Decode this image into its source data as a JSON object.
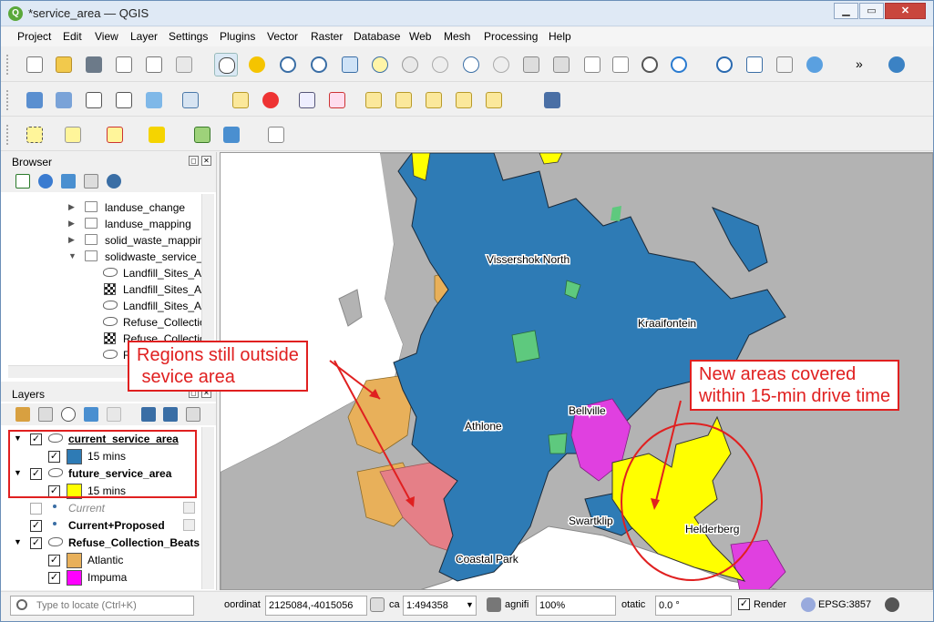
{
  "window": {
    "title": "*service_area — QGIS",
    "app_icon": "qgis-logo-icon",
    "buttons": {
      "minimize": "▁",
      "maximize": "▭",
      "close": "✕"
    }
  },
  "menu": [
    "Project",
    "Edit",
    "View",
    "Layer",
    "Settings",
    "Plugins",
    "Vector",
    "Raster",
    "Database",
    "Web",
    "Mesh",
    "Processing",
    "Help"
  ],
  "toolbar_overflow": "»",
  "browser": {
    "title": "Browser",
    "items": [
      {
        "label": "landuse_change",
        "type": "folder",
        "expanded": false
      },
      {
        "label": "landuse_mapping",
        "type": "folder",
        "expanded": false
      },
      {
        "label": "solid_waste_mappin",
        "type": "folder",
        "expanded": false
      },
      {
        "label": "solidwaste_service_a",
        "type": "folder",
        "expanded": true
      },
      {
        "label": "Landfill_Sites_Ar",
        "type": "polygon"
      },
      {
        "label": "Landfill_Sites_Ar",
        "type": "raster"
      },
      {
        "label": "Landfill_Sites_Ar",
        "type": "polygon"
      },
      {
        "label": "Refuse_Collection",
        "type": "polygon"
      },
      {
        "label": "Refuse_Collection",
        "type": "raster"
      },
      {
        "label": "R",
        "type": "polygon"
      }
    ]
  },
  "layers": {
    "title": "Layers",
    "rows": [
      {
        "label": "current_service_area",
        "bold": true,
        "underline": true,
        "checked": true,
        "kind": "group"
      },
      {
        "label": "15 mins",
        "checked": true,
        "swatch": "#2e7bb5",
        "kind": "class"
      },
      {
        "label": "future_service_area",
        "bold": true,
        "checked": true,
        "kind": "group"
      },
      {
        "label": "15 mins",
        "checked": true,
        "swatch": "#ffff00",
        "kind": "class"
      },
      {
        "label": "Current",
        "italic": true,
        "checked": false,
        "kind": "point"
      },
      {
        "label": "Current+Proposed",
        "bold": true,
        "checked": true,
        "kind": "point"
      },
      {
        "label": "Refuse_Collection_Beats",
        "bold": true,
        "checked": true,
        "kind": "group"
      },
      {
        "label": "Atlantic",
        "checked": true,
        "swatch": "#e8b05a",
        "kind": "class"
      },
      {
        "label": "Impuma",
        "checked": true,
        "swatch": "#ff00ff",
        "kind": "class"
      }
    ]
  },
  "map": {
    "labels": [
      "Vissershok North",
      "Kraaifontein",
      "Athlone",
      "Bellville",
      "Swartklip",
      "Helderberg",
      "Coastal Park"
    ],
    "colors": {
      "current": "#2e7bb5",
      "future": "#ffff00",
      "land": "#b3b3b3",
      "atlantic": "#e8b05a",
      "south": "#e57f87",
      "impuma": "#e040e0",
      "green": "#5ec97e"
    }
  },
  "annotations": {
    "left": "Regions still outside\n sevice area",
    "right": "New areas covered\nwithin 15-min drive time"
  },
  "status": {
    "locate_placeholder": "Type to locate (Ctrl+K)",
    "coordinate_label": "oordinat",
    "coordinate_value": "2125084,-4015056",
    "scale_label": "ca",
    "scale_value": "1:494358",
    "magnifier_label": "agnifi",
    "magnifier_value": "100%",
    "rotation_label": "otatic",
    "rotation_value": "0.0 °",
    "render_label": "Render",
    "crs": "EPSG:3857"
  }
}
